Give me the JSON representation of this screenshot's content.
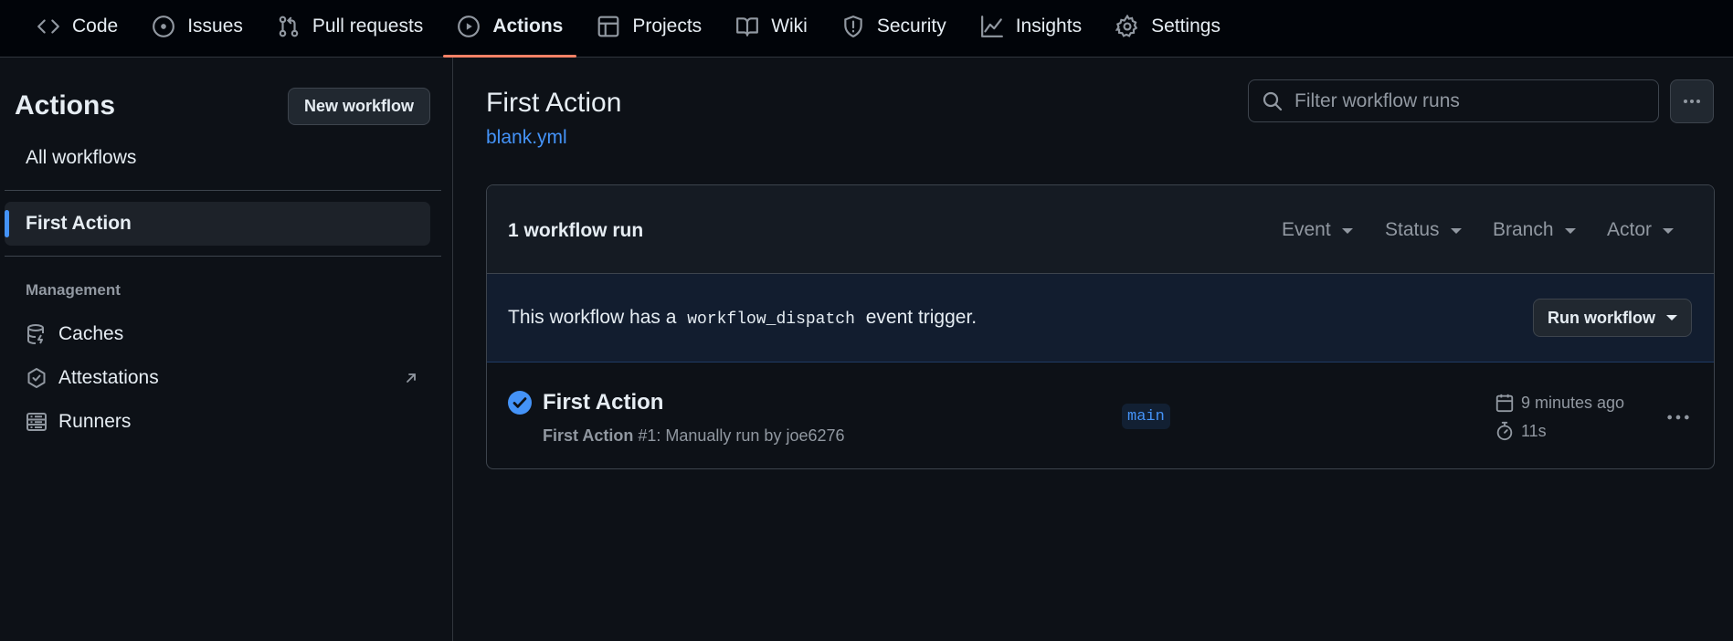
{
  "nav": {
    "tabs": [
      {
        "label": "Code",
        "icon": "code-icon"
      },
      {
        "label": "Issues",
        "icon": "issue-icon"
      },
      {
        "label": "Pull requests",
        "icon": "pull-request-icon"
      },
      {
        "label": "Actions",
        "icon": "play-icon",
        "active": true
      },
      {
        "label": "Projects",
        "icon": "table-icon"
      },
      {
        "label": "Wiki",
        "icon": "book-icon"
      },
      {
        "label": "Security",
        "icon": "shield-icon"
      },
      {
        "label": "Insights",
        "icon": "graph-icon"
      },
      {
        "label": "Settings",
        "icon": "gear-icon"
      }
    ]
  },
  "sidebar": {
    "title": "Actions",
    "new_workflow_label": "New workflow",
    "all_workflows_label": "All workflows",
    "selected_workflow": "First Action",
    "management_heading": "Management",
    "management_items": [
      {
        "label": "Caches",
        "icon": "database-icon"
      },
      {
        "label": "Attestations",
        "icon": "verified-icon"
      },
      {
        "label": "Runners",
        "icon": "server-icon"
      }
    ]
  },
  "main": {
    "title": "First Action",
    "file_link": "blank.yml",
    "filter_placeholder": "Filter workflow runs",
    "run_count_label": "1 workflow run",
    "filters": [
      "Event",
      "Status",
      "Branch",
      "Actor"
    ],
    "notice": {
      "before": "This workflow has a",
      "code": "workflow_dispatch",
      "after": "event trigger.",
      "button_label": "Run workflow"
    },
    "run": {
      "title": "First Action",
      "workflow_name": "First Action",
      "detail": "#1: Manually run by joe6276",
      "branch": "main",
      "time_ago": "9 minutes ago",
      "duration": "11s",
      "status": "success"
    }
  },
  "colors": {
    "accent": "#4493f8",
    "active_tab_underline": "#f78166",
    "success": "#4493f8"
  }
}
